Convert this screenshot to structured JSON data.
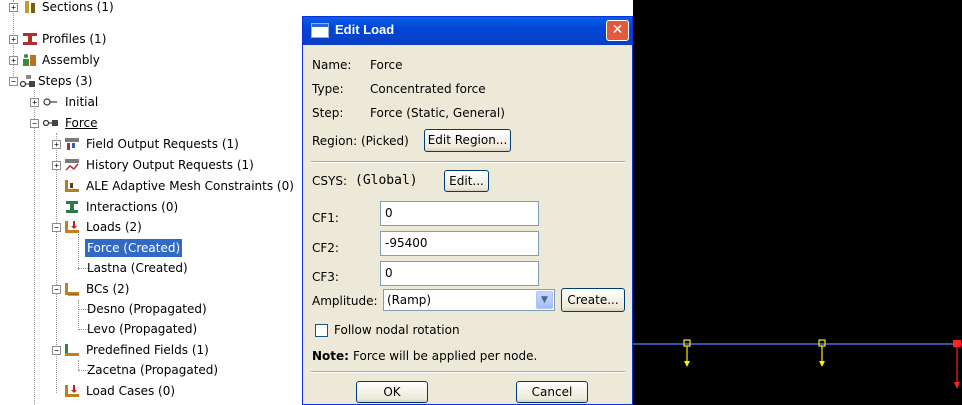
{
  "tree": {
    "items": [
      {
        "label": "Sections (1)",
        "expander": "+"
      },
      {
        "label": "Profiles (1)",
        "expander": "+"
      },
      {
        "label": "Assembly",
        "expander": "+"
      },
      {
        "label": "Steps (3)",
        "expander": "−"
      },
      {
        "label": "Initial",
        "expander": "+"
      },
      {
        "label": "Force",
        "expander": "−"
      },
      {
        "label": "Field Output Requests (1)",
        "expander": "+"
      },
      {
        "label": "History Output Requests (1)",
        "expander": "+"
      },
      {
        "label": "ALE Adaptive Mesh Constraints (0)",
        "expander": ""
      },
      {
        "label": "Interactions (0)",
        "expander": ""
      },
      {
        "label": "Loads (2)",
        "expander": "−"
      },
      {
        "label": "Force (Created)",
        "expander": ""
      },
      {
        "label": "Lastna (Created)",
        "expander": ""
      },
      {
        "label": "BCs (2)",
        "expander": "−"
      },
      {
        "label": "Desno (Propagated)",
        "expander": ""
      },
      {
        "label": "Levo (Propagated)",
        "expander": ""
      },
      {
        "label": "Predefined Fields (1)",
        "expander": "−"
      },
      {
        "label": "Zacetna (Propagated)",
        "expander": ""
      },
      {
        "label": "Load Cases (0)",
        "expander": ""
      }
    ]
  },
  "dialog": {
    "title": "Edit Load",
    "close_glyph": "✕",
    "name_label": "Name:",
    "name_value": "Force",
    "type_label": "Type:",
    "type_value": "Concentrated force",
    "step_label": "Step:",
    "step_value": "Force (Static, General)",
    "region_label": "Region:",
    "region_value": "(Picked)",
    "edit_region_button": "Edit Region...",
    "csys_label": "CSYS:",
    "csys_value": "(Global)",
    "csys_edit_button": "Edit...",
    "cf1_label": "CF1:",
    "cf1_value": "0",
    "cf2_label": "CF2:",
    "cf2_value": "-95400",
    "cf3_label": "CF3:",
    "cf3_value": "0",
    "amplitude_label": "Amplitude:",
    "amplitude_value": "(Ramp)",
    "amplitude_arrow": "▼",
    "create_button": "Create...",
    "follow_label": "Follow nodal rotation",
    "follow_checked": false,
    "note_label": "Note:",
    "note_text": "Force will be applied per node.",
    "ok_button": "OK",
    "cancel_button": "Cancel"
  },
  "colors": {
    "viewport_bg": "#000000",
    "beam": "#4a6fd6",
    "load_arrow": "#ffee00",
    "highlight_load": "#ff2020",
    "selection": "#316ac5",
    "dialog_title": "#0046d6"
  }
}
